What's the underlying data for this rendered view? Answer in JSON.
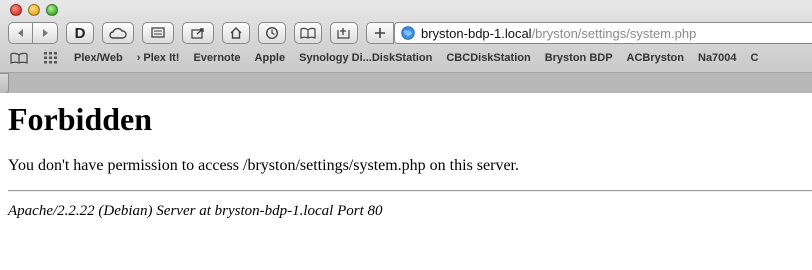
{
  "toolbar": {
    "d_button_label": "D",
    "url": {
      "host": "bryston-bdp-1.local",
      "path": "/bryston/settings/system.php"
    }
  },
  "bookmarks": [
    {
      "label": "Plex/Web"
    },
    {
      "label": "Plex It!",
      "folder": true
    },
    {
      "label": "Evernote"
    },
    {
      "label": "Apple"
    },
    {
      "label": "Synology Di...DiskStation"
    },
    {
      "label": "CBCDiskStation"
    },
    {
      "label": "Bryston BDP"
    },
    {
      "label": "ACBryston"
    },
    {
      "label": "Na7004"
    },
    {
      "label": "C"
    }
  ],
  "page": {
    "heading": "Forbidden",
    "message": "You don't have permission to access /bryston/settings/system.php on this server.",
    "footer": "Apache/2.2.22 (Debian) Server at bryston-bdp-1.local Port 80"
  },
  "colors": {
    "url_host": "#111111",
    "url_path": "#8b8b8b",
    "chrome_bg": "#cfcfcf"
  }
}
